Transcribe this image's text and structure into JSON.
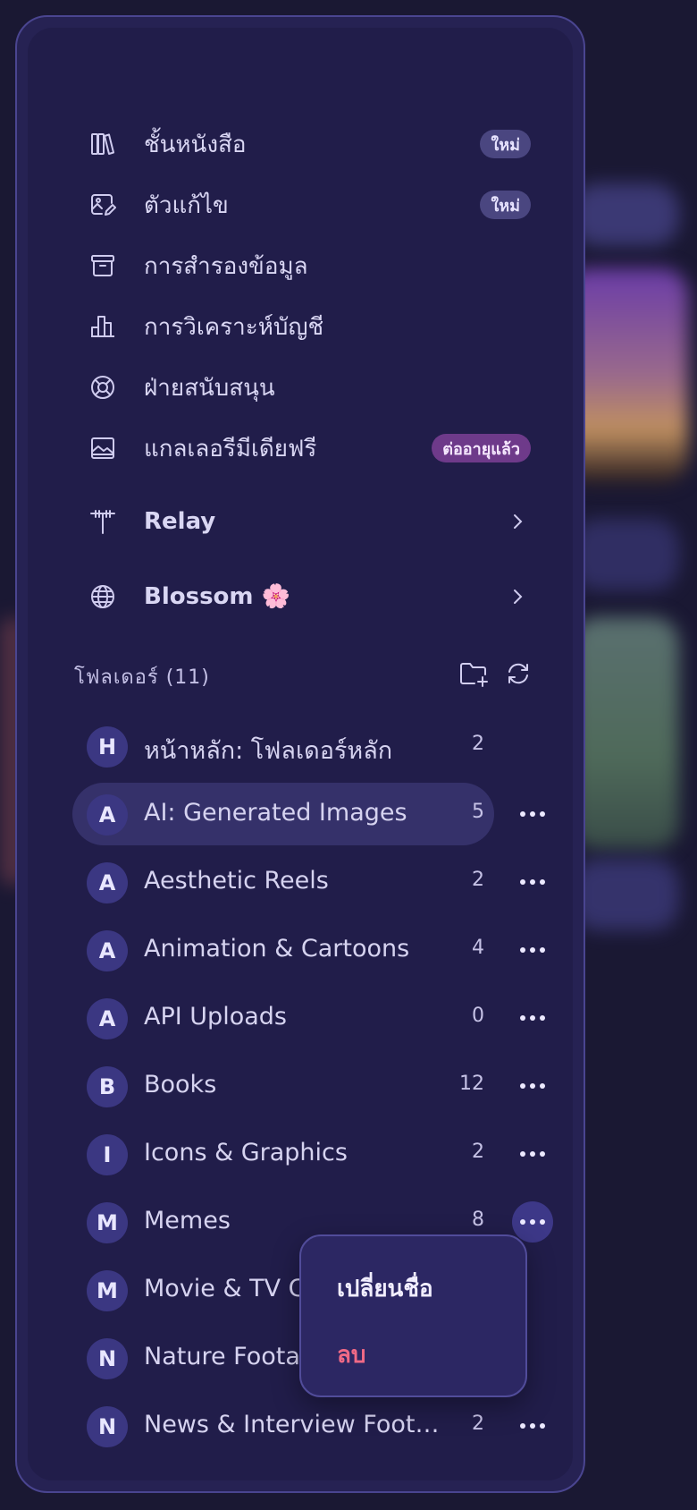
{
  "menu_items": [
    {
      "label": "ชั้นหนังสือ",
      "badge": "ใหม่",
      "icon": "library-icon"
    },
    {
      "label": "ตัวแก้ไข",
      "badge": "ใหม่",
      "icon": "image-edit-icon"
    },
    {
      "label": "การสำรองข้อมูล",
      "badge": "",
      "icon": "archive-icon"
    },
    {
      "label": "การวิเคราะห์บัญชี",
      "badge": "",
      "icon": "bar-chart-icon"
    },
    {
      "label": "ฝ่ายสนับสนุน",
      "badge": "",
      "icon": "lifebuoy-icon"
    },
    {
      "label": "แกลเลอรีมีเดียฟรี",
      "badge": "ต่ออายุแล้ว",
      "icon": "gallery-icon"
    }
  ],
  "nav_links": [
    {
      "label": "Relay",
      "icon": "antenna-icon"
    },
    {
      "label": "Blossom 🌸",
      "icon": "globe-icon"
    }
  ],
  "folders_section": {
    "title": "โฟลเดอร์ (11)",
    "new_folder_icon": "folder-plus-icon",
    "refresh_icon": "refresh-icon"
  },
  "folders": [
    {
      "letter": "H",
      "name": "หน้าหลัก: โฟลเดอร์หลัก",
      "count": "2"
    },
    {
      "letter": "A",
      "name": "AI: Generated Images",
      "count": "5"
    },
    {
      "letter": "A",
      "name": "Aesthetic Reels",
      "count": "2"
    },
    {
      "letter": "A",
      "name": "Animation & Cartoons",
      "count": "4"
    },
    {
      "letter": "A",
      "name": "API Uploads",
      "count": "0"
    },
    {
      "letter": "B",
      "name": "Books",
      "count": "12"
    },
    {
      "letter": "I",
      "name": "Icons & Graphics",
      "count": "2"
    },
    {
      "letter": "M",
      "name": "Memes",
      "count": "8"
    },
    {
      "letter": "M",
      "name": "Movie & TV Clips",
      "count": ""
    },
    {
      "letter": "N",
      "name": "Nature Footage",
      "count": ""
    },
    {
      "letter": "N",
      "name": "News & Interview Footage",
      "count": "2"
    }
  ],
  "context_menu": {
    "rename": "เปลี่ยนชื่อ",
    "delete": "ลบ"
  },
  "colors": {
    "panel": "#262253",
    "accent": "#3b3782",
    "danger": "#f06a86"
  }
}
